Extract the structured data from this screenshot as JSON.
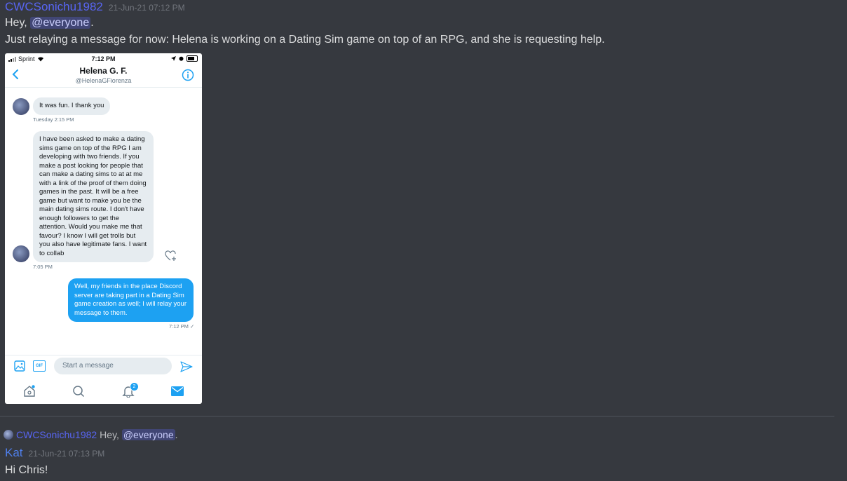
{
  "message1": {
    "username": "CWCSonichu1982",
    "timestamp": "21-Jun-21 07:12 PM",
    "line1_prefix": "Hey, ",
    "line1_mention": "@everyone",
    "line1_suffix": ".",
    "line2": "Just relaying a message for now: Helena is working on a Dating Sim game on top of an RPG, and she is requesting help."
  },
  "phone": {
    "status": {
      "carrier": "Sprint",
      "time": "7:12 PM"
    },
    "header": {
      "name": "Helena G. F.",
      "handle": "@HelenaGFiorenza"
    },
    "messages": [
      {
        "text": "It was fun. I thank you",
        "time": "Tuesday 2:15 PM"
      },
      {
        "text": "I have been asked to make a dating sims game on top of the RPG I am developing with two friends. If you make a post looking for people that can make a dating sims to at at me with a link of the proof of them doing games in the past. It will be a free game but want to make you be the main dating sims route. I don't have enough followers to get the attention. Would you make me that favour? I know I will get trolls but you also have legitimate fans. I want to collab",
        "time": "7:05 PM"
      },
      {
        "text": "Well, my friends in the place Discord server are taking part in a Dating Sim game creation as well; I will relay your message to them.",
        "time": "7:12 PM ✓"
      }
    ],
    "composer": {
      "placeholder": "Start a message",
      "gif_label": "GIF"
    },
    "notification_count": "2"
  },
  "reply": {
    "username": "CWCSonichu1982",
    "prefix": "Hey, ",
    "mention": "@everyone",
    "suffix": "."
  },
  "message2": {
    "username": "Kat",
    "timestamp": "21-Jun-21 07:13 PM",
    "text": "Hi Chris!"
  },
  "colors": {
    "background": "#36393f",
    "username_purple": "#5865f2",
    "mention_bg": "#414675",
    "twitter_blue": "#1da1f2"
  }
}
